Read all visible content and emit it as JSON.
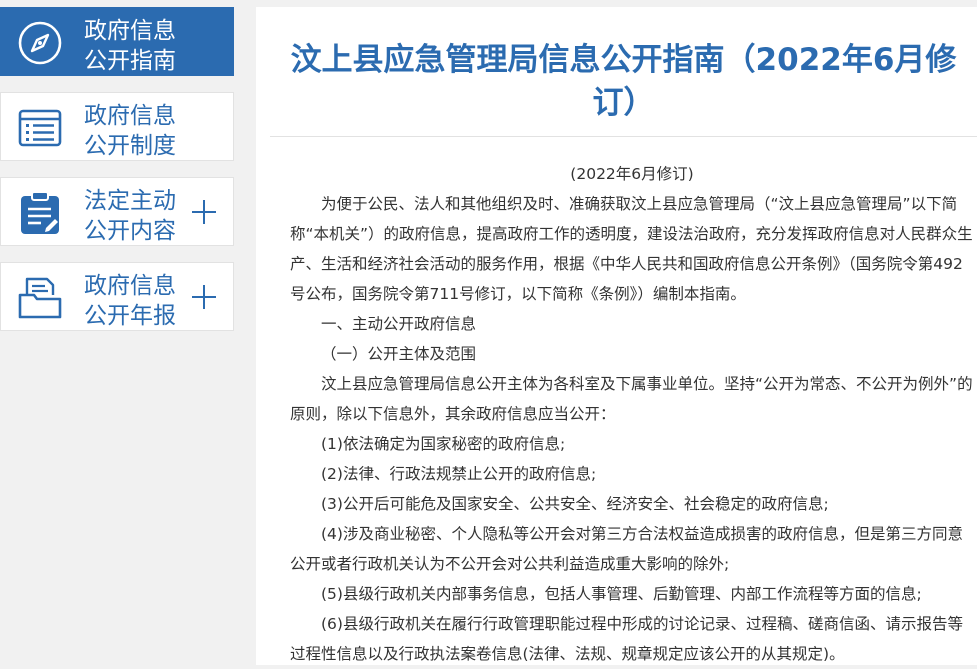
{
  "sidebar": {
    "items": [
      {
        "line1": "政府信息",
        "line2": "公开指南",
        "icon": "compass-icon",
        "active": true,
        "expandable": false
      },
      {
        "line1": "政府信息",
        "line2": "公开制度",
        "icon": "list-document-icon",
        "active": false,
        "expandable": false
      },
      {
        "line1": "法定主动",
        "line2": "公开内容",
        "icon": "clipboard-icon",
        "active": false,
        "expandable": true
      },
      {
        "line1": "政府信息",
        "line2": "公开年报",
        "icon": "folder-document-icon",
        "active": false,
        "expandable": true
      }
    ]
  },
  "article": {
    "title": "汶上县应急管理局信息公开指南（2022年6月修订）",
    "revision_note": "(2022年6月修订)",
    "paragraphs": [
      "为便于公民、法人和其他组织及时、准确获取汶上县应急管理局（“汶上县应急管理局”以下简称“本机关”）的政府信息，提高政府工作的透明度，建设法治政府，充分发挥政府信息对人民群众生产、生活和经济社会活动的服务作用，根据《中华人民共和国政府信息公开条例》（国务院令第492号公布，国务院令第711号修订，以下简称《条例》）编制本指南。",
      "一、主动公开政府信息",
      "（一）公开主体及范围",
      "汶上县应急管理局信息公开主体为各科室及下属事业单位。坚持“公开为常态、不公开为例外”的原则，除以下信息外，其余政府信息应当公开：",
      "(1)依法确定为国家秘密的政府信息;",
      "(2)法律、行政法规禁止公开的政府信息;",
      "(3)公开后可能危及国家安全、公共安全、经济安全、社会稳定的政府信息;",
      "(4)涉及商业秘密、个人隐私等公开会对第三方合法权益造成损害的政府信息，但是第三方同意公开或者行政机关认为不公开会对公共利益造成重大影响的除外;",
      "(5)县级行政机关内部事务信息，包括人事管理、后勤管理、内部工作流程等方面的信息;",
      "(6)县级行政机关在履行行政管理职能过程中形成的讨论记录、过程稿、磋商信函、请示报告等过程性信息以及行政执法案卷信息(法律、法规、规章规定应该公开的从其规定)。"
    ]
  },
  "colors": {
    "accent": "#2b6bb0",
    "background": "#f1f1f1",
    "text": "#333333"
  }
}
